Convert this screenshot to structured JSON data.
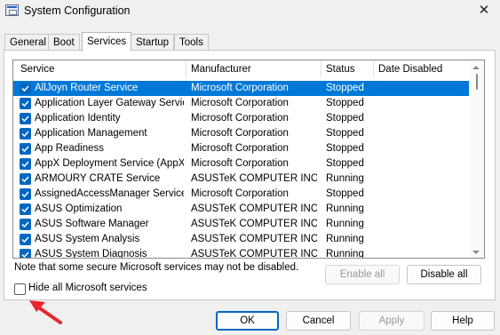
{
  "window": {
    "title": "System Configuration",
    "close_glyph": "✕"
  },
  "tabs": [
    {
      "label": "General",
      "active": false
    },
    {
      "label": "Boot",
      "active": false
    },
    {
      "label": "Services",
      "active": true
    },
    {
      "label": "Startup",
      "active": false
    },
    {
      "label": "Tools",
      "active": false
    }
  ],
  "columns": [
    "Service",
    "Manufacturer",
    "Status",
    "Date Disabled"
  ],
  "services": [
    {
      "name": "AllJoyn Router Service",
      "manufacturer": "Microsoft Corporation",
      "status": "Stopped",
      "date_disabled": "",
      "checked": true,
      "selected": true
    },
    {
      "name": "Application Layer Gateway Service",
      "manufacturer": "Microsoft Corporation",
      "status": "Stopped",
      "date_disabled": "",
      "checked": true,
      "selected": false
    },
    {
      "name": "Application Identity",
      "manufacturer": "Microsoft Corporation",
      "status": "Stopped",
      "date_disabled": "",
      "checked": true,
      "selected": false
    },
    {
      "name": "Application Management",
      "manufacturer": "Microsoft Corporation",
      "status": "Stopped",
      "date_disabled": "",
      "checked": true,
      "selected": false
    },
    {
      "name": "App Readiness",
      "manufacturer": "Microsoft Corporation",
      "status": "Stopped",
      "date_disabled": "",
      "checked": true,
      "selected": false
    },
    {
      "name": "AppX Deployment Service (AppX...",
      "manufacturer": "Microsoft Corporation",
      "status": "Stopped",
      "date_disabled": "",
      "checked": true,
      "selected": false
    },
    {
      "name": "ARMOURY CRATE Service",
      "manufacturer": "ASUSTeK COMPUTER INC.",
      "status": "Running",
      "date_disabled": "",
      "checked": true,
      "selected": false
    },
    {
      "name": "AssignedAccessManager Service",
      "manufacturer": "Microsoft Corporation",
      "status": "Stopped",
      "date_disabled": "",
      "checked": true,
      "selected": false
    },
    {
      "name": "ASUS Optimization",
      "manufacturer": "ASUSTeK COMPUTER INC.",
      "status": "Running",
      "date_disabled": "",
      "checked": true,
      "selected": false
    },
    {
      "name": "ASUS Software Manager",
      "manufacturer": "ASUSTeK COMPUTER INC.",
      "status": "Running",
      "date_disabled": "",
      "checked": true,
      "selected": false
    },
    {
      "name": "ASUS System Analysis",
      "manufacturer": "ASUSTeK COMPUTER INC.",
      "status": "Running",
      "date_disabled": "",
      "checked": true,
      "selected": false
    },
    {
      "name": "ASUS System Diagnosis",
      "manufacturer": "ASUSTeK COMPUTER INC.",
      "status": "Running",
      "date_disabled": "",
      "checked": true,
      "selected": false
    }
  ],
  "note": "Note that some secure Microsoft services may not be disabled.",
  "buttons": {
    "enable_all": "Enable all",
    "disable_all": "Disable all",
    "ok": "OK",
    "cancel": "Cancel",
    "apply": "Apply",
    "help": "Help"
  },
  "hide_ms": {
    "label": "Hide all Microsoft services",
    "checked": false
  },
  "colors": {
    "selection": "#0078d7",
    "checkbox": "#0067c0",
    "annotation_arrow": "#e8262b"
  }
}
